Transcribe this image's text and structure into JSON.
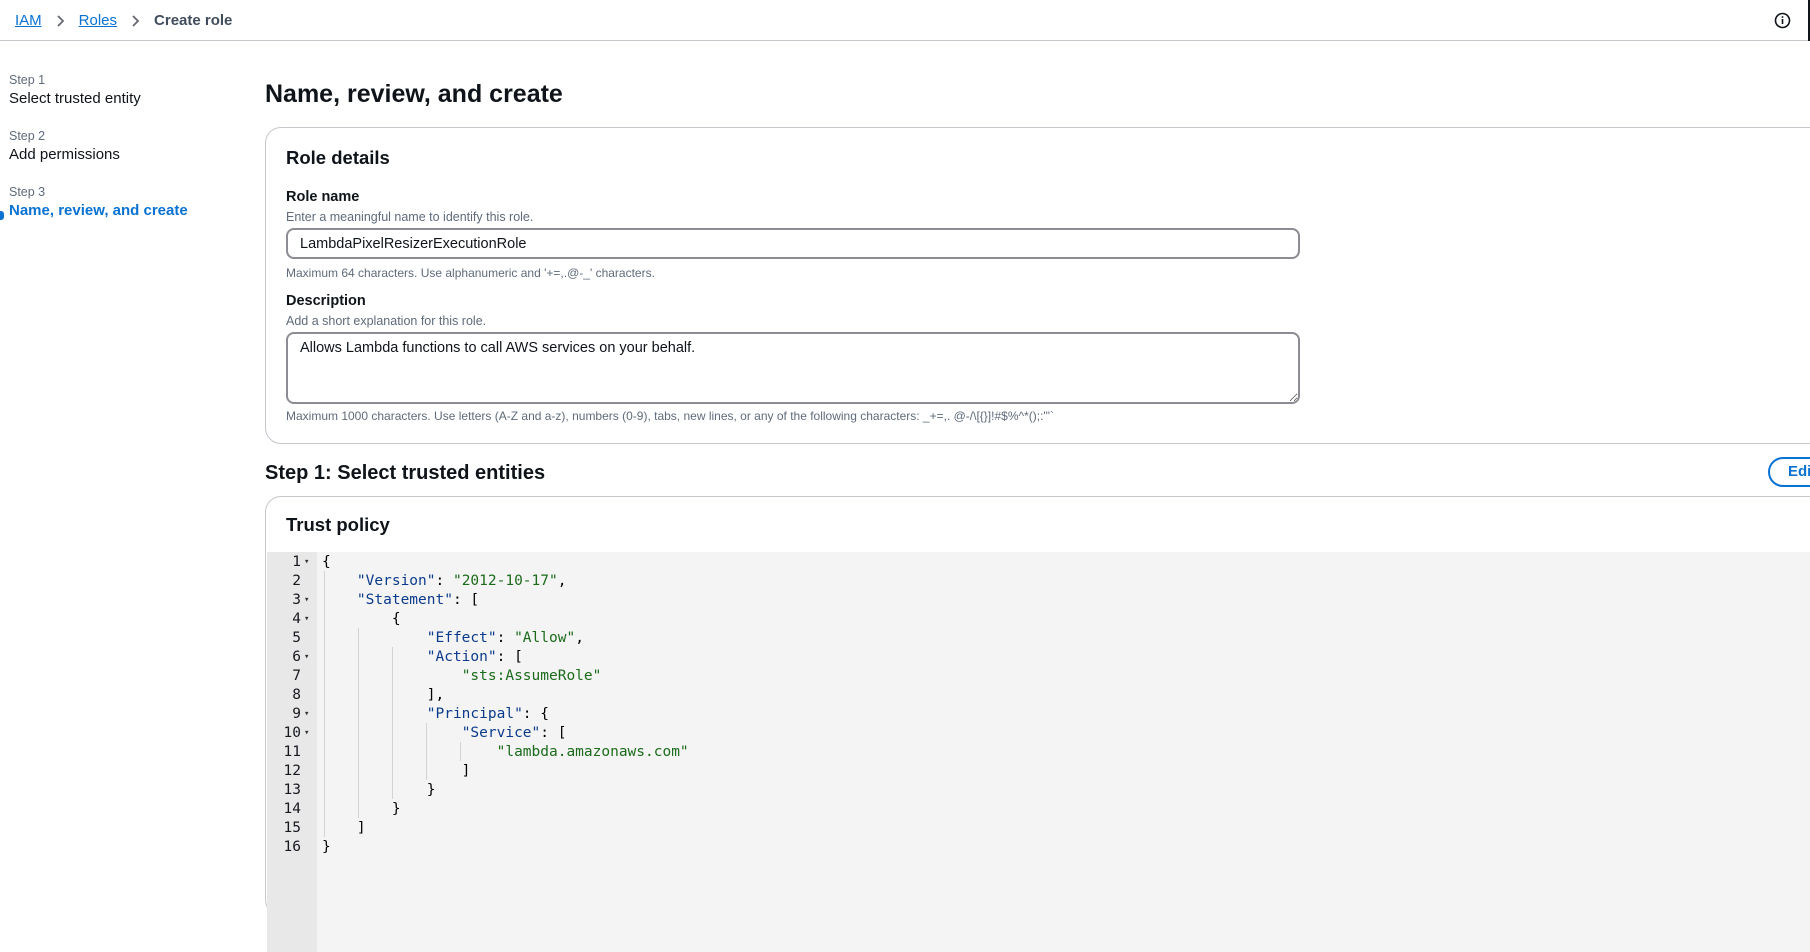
{
  "breadcrumb": {
    "items": [
      "IAM",
      "Roles"
    ],
    "current": "Create role"
  },
  "steps": [
    {
      "label": "Step 1",
      "title": "Select trusted entity",
      "active": false
    },
    {
      "label": "Step 2",
      "title": "Add permissions",
      "active": false
    },
    {
      "label": "Step 3",
      "title": "Name, review, and create",
      "active": true
    }
  ],
  "page": {
    "title": "Name, review, and create"
  },
  "role_details": {
    "title": "Role details",
    "role_name": {
      "label": "Role name",
      "description": "Enter a meaningful name to identify this role.",
      "value": "LambdaPixelResizerExecutionRole",
      "constraint": "Maximum 64 characters. Use alphanumeric and '+=,.@-_' characters."
    },
    "description": {
      "label": "Description",
      "description": "Add a short explanation for this role.",
      "value": "Allows Lambda functions to call AWS services on your behalf.",
      "constraint": "Maximum 1000 characters. Use letters (A-Z and a-z), numbers (0-9), tabs, new lines, or any of the following characters: _+=,. @-/\\[{}]!#$%^*();:\"'`"
    }
  },
  "step1": {
    "title": "Step 1: Select trusted entities",
    "edit_label": "Edi"
  },
  "trust_policy": {
    "title": "Trust policy",
    "lines": [
      {
        "num": "1",
        "fold": true,
        "text": "{"
      },
      {
        "num": "2",
        "fold": false,
        "text": "    \"Version\": \"2012-10-17\","
      },
      {
        "num": "3",
        "fold": true,
        "text": "    \"Statement\": ["
      },
      {
        "num": "4",
        "fold": true,
        "text": "        {"
      },
      {
        "num": "5",
        "fold": false,
        "text": "            \"Effect\": \"Allow\","
      },
      {
        "num": "6",
        "fold": true,
        "text": "            \"Action\": ["
      },
      {
        "num": "7",
        "fold": false,
        "text": "                \"sts:AssumeRole\""
      },
      {
        "num": "8",
        "fold": false,
        "text": "            ],"
      },
      {
        "num": "9",
        "fold": true,
        "text": "            \"Principal\": {"
      },
      {
        "num": "10",
        "fold": true,
        "text": "                \"Service\": ["
      },
      {
        "num": "11",
        "fold": false,
        "text": "                    \"lambda.amazonaws.com\""
      },
      {
        "num": "12",
        "fold": false,
        "text": "                ]"
      },
      {
        "num": "13",
        "fold": false,
        "text": "            }"
      },
      {
        "num": "14",
        "fold": false,
        "text": "        }"
      },
      {
        "num": "15",
        "fold": false,
        "text": "    ]"
      },
      {
        "num": "16",
        "fold": false,
        "text": "}"
      }
    ]
  },
  "icons": {
    "info": "info-icon",
    "separator": "chevron-right-icon",
    "fold": "fold-arrow-icon"
  },
  "colors": {
    "link": "#0972d3",
    "text": "#0f141a",
    "muted": "#5f6b7a",
    "border": "#c6c6cd"
  }
}
